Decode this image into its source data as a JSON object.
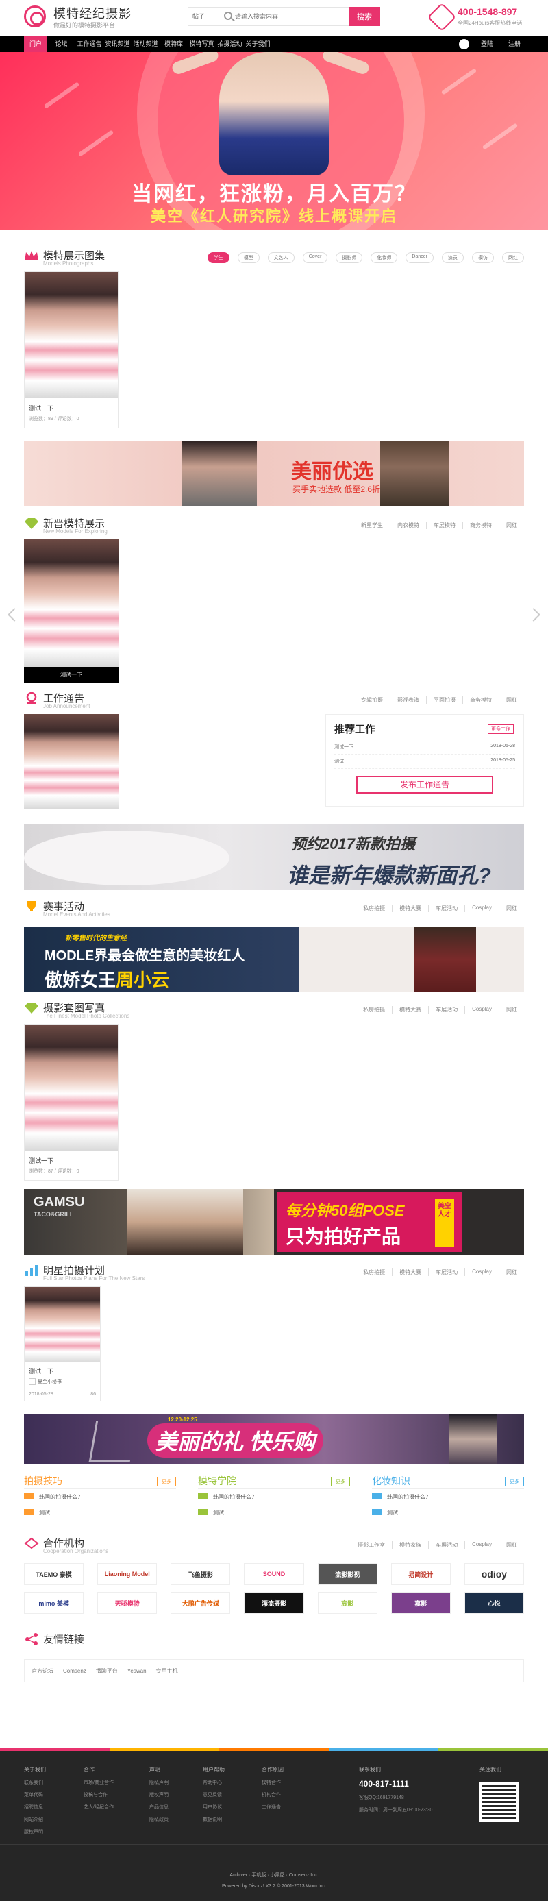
{
  "header": {
    "logo_title": "模特经纪摄影",
    "logo_sub": "做最好的模特摄影平台",
    "search_category": "帖子",
    "search_placeholder": "请输入搜索内容",
    "search_button": "搜索",
    "phone": "400-1548-897",
    "phone_sub": "全国24Hours客服热线电话"
  },
  "nav": {
    "items": [
      "门户",
      "论坛",
      "工作通告",
      "资讯频道",
      "活动频道",
      "模特库",
      "模特写真",
      "拍摄活动",
      "关于我们"
    ],
    "login": "登陆",
    "register": "注册"
  },
  "banner": {
    "line1": "当网红，狂涨粉，月入百万？",
    "line2": "美空《红人研究院》线上概课开启"
  },
  "sec_models": {
    "title": "模特展示图集",
    "sub": "Models Photographs",
    "pills": [
      "学生",
      "模型",
      "文艺人",
      "Cover",
      "摄影师",
      "化妆师",
      "Dancer",
      "演员",
      "模仿",
      "网红"
    ],
    "card_caption": "测试一下",
    "card_meta": "浏览数：89 / 评论数：0"
  },
  "ad1": {
    "title": "美丽优选",
    "sub": "买手实地选款  低至2.6折"
  },
  "sec_newmodels": {
    "title": "新晋模特展示",
    "sub": "New Models For Exploring",
    "links": [
      "新星学生",
      "内衣模特",
      "车展模特",
      "商务模特",
      "网红"
    ],
    "card_caption": "测试一下"
  },
  "sec_jobs": {
    "title": "工作通告",
    "sub": "Job Announcement",
    "links": [
      "专辑拍摄",
      "影视表演",
      "平面拍摄",
      "商务模特",
      "网红"
    ],
    "recommend_title": "推荐工作",
    "recommend_btn": "更多工作",
    "rows": [
      {
        "name": "测试一下",
        "date": "2018-05-28"
      },
      {
        "name": "测试",
        "date": "2018-05-25"
      }
    ],
    "publish_btn": "发布工作通告"
  },
  "ad2": {
    "line1": "预约2017新款拍摄",
    "line2": "谁是新年爆款新面孔?"
  },
  "sec_events": {
    "title": "赛事活动",
    "sub": "Model Events And Activities",
    "links": [
      "私房拍摄",
      "模特大赛",
      "车展活动",
      "Cosplay",
      "网红"
    ]
  },
  "ad3": {
    "line0": "新零售时代的生意经",
    "line1": "MODLE界最会做生意的美妆红人",
    "line2": "傲娇女王",
    "line2b": "周小云"
  },
  "sec_albums": {
    "title": "摄影套图写真",
    "sub": "The Finest Model Photo Collections",
    "links": [
      "私房拍摄",
      "模特大赛",
      "车展活动",
      "Cosplay",
      "网红"
    ],
    "card_caption": "测试一下",
    "card_meta": "浏览数：87 / 评论数：0"
  },
  "ad4": {
    "brand": "GAMSU",
    "brand_sub": "TACO&GRILL",
    "line1": "每分钟50组POSE",
    "line2": "只为拍好产品",
    "tag": "美空人才"
  },
  "sec_plans": {
    "title": "明星拍摄计划",
    "sub": "Full Star Photos Plans For The New Stars",
    "links": [
      "私房拍摄",
      "模特大赛",
      "车展活动",
      "Cosplay",
      "网红"
    ],
    "card_caption": "测试一下",
    "card_author": "夏至小秘书",
    "card_date": "2018-05-28",
    "card_count": "86"
  },
  "ad5": {
    "text": "美丽的礼 快乐购",
    "date": "12.20-12.25"
  },
  "triple": [
    {
      "title": "拍摄技巧",
      "more": "更多",
      "color": "#ff9b2f",
      "items": [
        "韩国的拍摄什么？",
        "测试"
      ]
    },
    {
      "title": "模特学院",
      "more": "更多",
      "color": "#9ac43a",
      "items": [
        "韩国的拍摄什么？",
        "测试"
      ]
    },
    {
      "title": "化妆知识",
      "more": "更多",
      "color": "#4ab0e8",
      "items": [
        "韩国的拍摄什么？",
        "测试"
      ]
    }
  ],
  "sec_partners": {
    "title": "合作机构",
    "sub": "Cooperation Organizations",
    "links": [
      "摄影工作室",
      "模特家族",
      "车展活动",
      "Cosplay",
      "网红"
    ],
    "logos": [
      "TAEMO 泰模",
      "Liaoning Model",
      "飞鱼摄影",
      "SOUND",
      "流影影视",
      "易简设计",
      "odioy",
      "mimo 美模",
      "天骄模特",
      "大鹏广告传媒",
      "漂流摄影",
      "宸影",
      "嘉影",
      "心悦"
    ]
  },
  "sec_links": {
    "title": "友情链接",
    "items": [
      "官方论坛",
      "Comsenz",
      "播聊平台",
      "Yeswan",
      "专用主机"
    ]
  },
  "footer": {
    "cols": [
      {
        "h": "关于我们",
        "items": [
          "联系我们",
          "菜单代码",
          "招聘信息",
          "网站介绍",
          "版权声明"
        ]
      },
      {
        "h": "合作",
        "items": [
          "市场/商业合作",
          "投稿与合作",
          "艺人/经纪合作"
        ]
      },
      {
        "h": "声明",
        "items": [
          "隐私声明",
          "版权声明",
          "产品信息",
          "隐私政策"
        ]
      },
      {
        "h": "用户帮助",
        "items": [
          "帮助中心",
          "意见反馈",
          "用户协议",
          "数据说明"
        ]
      },
      {
        "h": "合作原因",
        "items": [
          "模特合作",
          "机构合作",
          "工作通告"
        ]
      }
    ],
    "contact_h": "联系我们",
    "phone": "400-817-1111",
    "qq": "客服QQ:1691779148",
    "hours": "服务时间：周一到周五09:00-23:30",
    "qr_h": "关注我们",
    "line1": "Archiver · 手机版 · 小黑屋 · Comsenz Inc.",
    "line2": "Powered by Discuz! X3.2 © 2001-2013 Wom Inc."
  },
  "colors": {
    "accent": "#e8336d",
    "dark": "#262626"
  }
}
